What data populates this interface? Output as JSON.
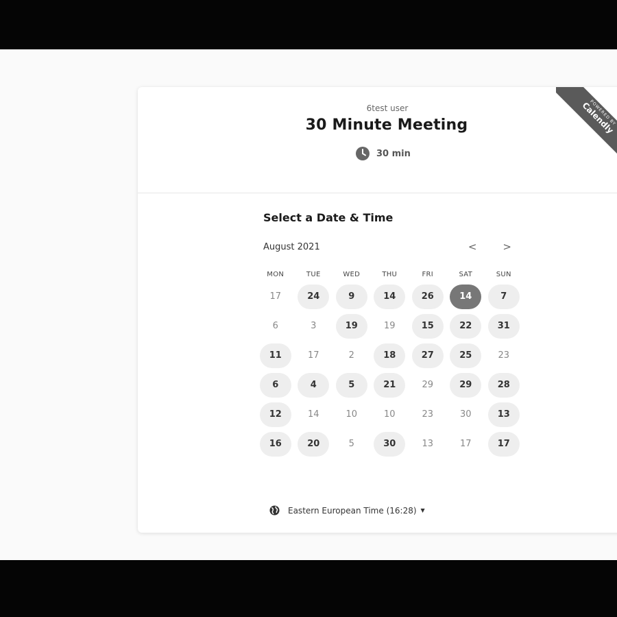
{
  "header": {
    "owner": "6test user",
    "title": "30 Minute Meeting",
    "duration": "30 min",
    "duration_icon": "clock-icon"
  },
  "ribbon": {
    "powered": "POWERED BY",
    "brand": "Calendly"
  },
  "scheduler": {
    "section_title": "Select a Date & Time",
    "month": "August 2021",
    "prev_label": "<",
    "next_label": ">",
    "weekdays": [
      "MON",
      "TUE",
      "WED",
      "THU",
      "FRI",
      "SAT",
      "SUN"
    ],
    "days": [
      {
        "label": "17",
        "available": false,
        "selected": false
      },
      {
        "label": "24",
        "available": true,
        "selected": false
      },
      {
        "label": "9",
        "available": true,
        "selected": false
      },
      {
        "label": "14",
        "available": true,
        "selected": false
      },
      {
        "label": "26",
        "available": true,
        "selected": false
      },
      {
        "label": "14",
        "available": true,
        "selected": true
      },
      {
        "label": "7",
        "available": true,
        "selected": false
      },
      {
        "label": "6",
        "available": false,
        "selected": false
      },
      {
        "label": "3",
        "available": false,
        "selected": false
      },
      {
        "label": "19",
        "available": true,
        "selected": false
      },
      {
        "label": "19",
        "available": false,
        "selected": false
      },
      {
        "label": "15",
        "available": true,
        "selected": false
      },
      {
        "label": "22",
        "available": true,
        "selected": false
      },
      {
        "label": "31",
        "available": true,
        "selected": false
      },
      {
        "label": "11",
        "available": true,
        "selected": false
      },
      {
        "label": "17",
        "available": false,
        "selected": false
      },
      {
        "label": "2",
        "available": false,
        "selected": false
      },
      {
        "label": "18",
        "available": true,
        "selected": false
      },
      {
        "label": "27",
        "available": true,
        "selected": false
      },
      {
        "label": "25",
        "available": true,
        "selected": false
      },
      {
        "label": "23",
        "available": false,
        "selected": false
      },
      {
        "label": "6",
        "available": true,
        "selected": false
      },
      {
        "label": "4",
        "available": true,
        "selected": false
      },
      {
        "label": "5",
        "available": true,
        "selected": false
      },
      {
        "label": "21",
        "available": true,
        "selected": false
      },
      {
        "label": "29",
        "available": false,
        "selected": false
      },
      {
        "label": "29",
        "available": true,
        "selected": false
      },
      {
        "label": "28",
        "available": true,
        "selected": false
      },
      {
        "label": "12",
        "available": true,
        "selected": false
      },
      {
        "label": "14",
        "available": false,
        "selected": false
      },
      {
        "label": "10",
        "available": false,
        "selected": false
      },
      {
        "label": "10",
        "available": false,
        "selected": false
      },
      {
        "label": "23",
        "available": false,
        "selected": false
      },
      {
        "label": "30",
        "available": false,
        "selected": false
      },
      {
        "label": "13",
        "available": true,
        "selected": false
      },
      {
        "label": "16",
        "available": true,
        "selected": false
      },
      {
        "label": "20",
        "available": true,
        "selected": false
      },
      {
        "label": "5",
        "available": false,
        "selected": false
      },
      {
        "label": "30",
        "available": true,
        "selected": false
      },
      {
        "label": "13",
        "available": false,
        "selected": false
      },
      {
        "label": "17",
        "available": false,
        "selected": false
      },
      {
        "label": "17",
        "available": true,
        "selected": false
      }
    ],
    "timezone": "Eastern European Time (16:28)",
    "timezone_icon": "globe-icon"
  },
  "colors": {
    "page_bg": "#fafafa",
    "card_bg": "#ffffff",
    "available_bg": "#eeeeee",
    "selected_bg": "#777777",
    "ribbon_bg": "#5a5a5a",
    "letterbox": "#050505"
  }
}
